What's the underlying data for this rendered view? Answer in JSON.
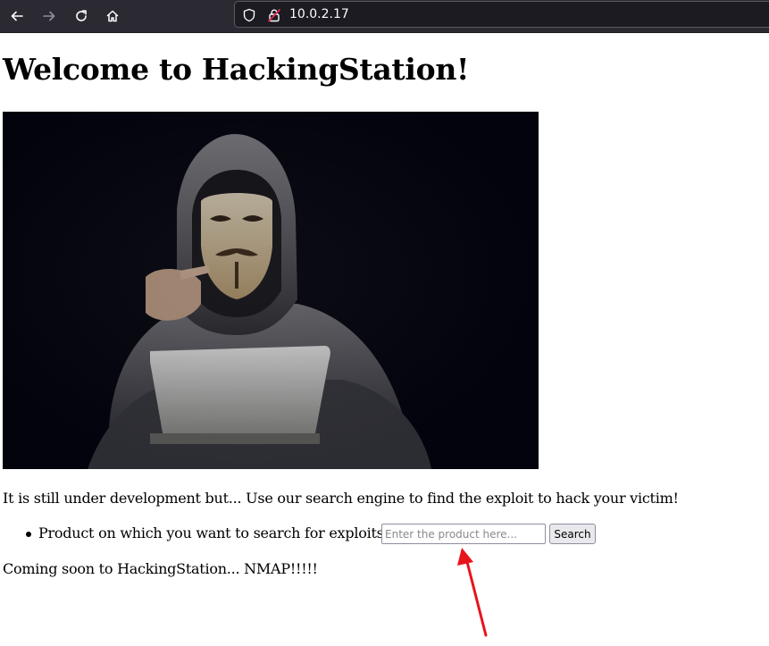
{
  "browser": {
    "url": "10.0.2.17",
    "icons": [
      "back-arrow-icon",
      "forward-arrow-icon",
      "reload-icon",
      "home-icon",
      "shield-icon",
      "insecure-lock-icon"
    ]
  },
  "page": {
    "title": "Welcome to HackingStation!",
    "hero_image": "hooded-hacker-with-mask-and-laptop",
    "intro": "It is still under development but... Use our search engine to find the exploit to hack your victim!",
    "search": {
      "label": "Product on which you want to search for exploits:",
      "placeholder": "Enter the product here...",
      "value": "",
      "button_label": "Search"
    },
    "footer": "Coming soon to HackingStation... NMAP!!!!!"
  },
  "annotation": {
    "arrow_color": "#e8141c"
  },
  "colors": {
    "toolbar": "#2b2a33",
    "urlbar": "#1c1b22",
    "hero_bg": "#03030d"
  }
}
